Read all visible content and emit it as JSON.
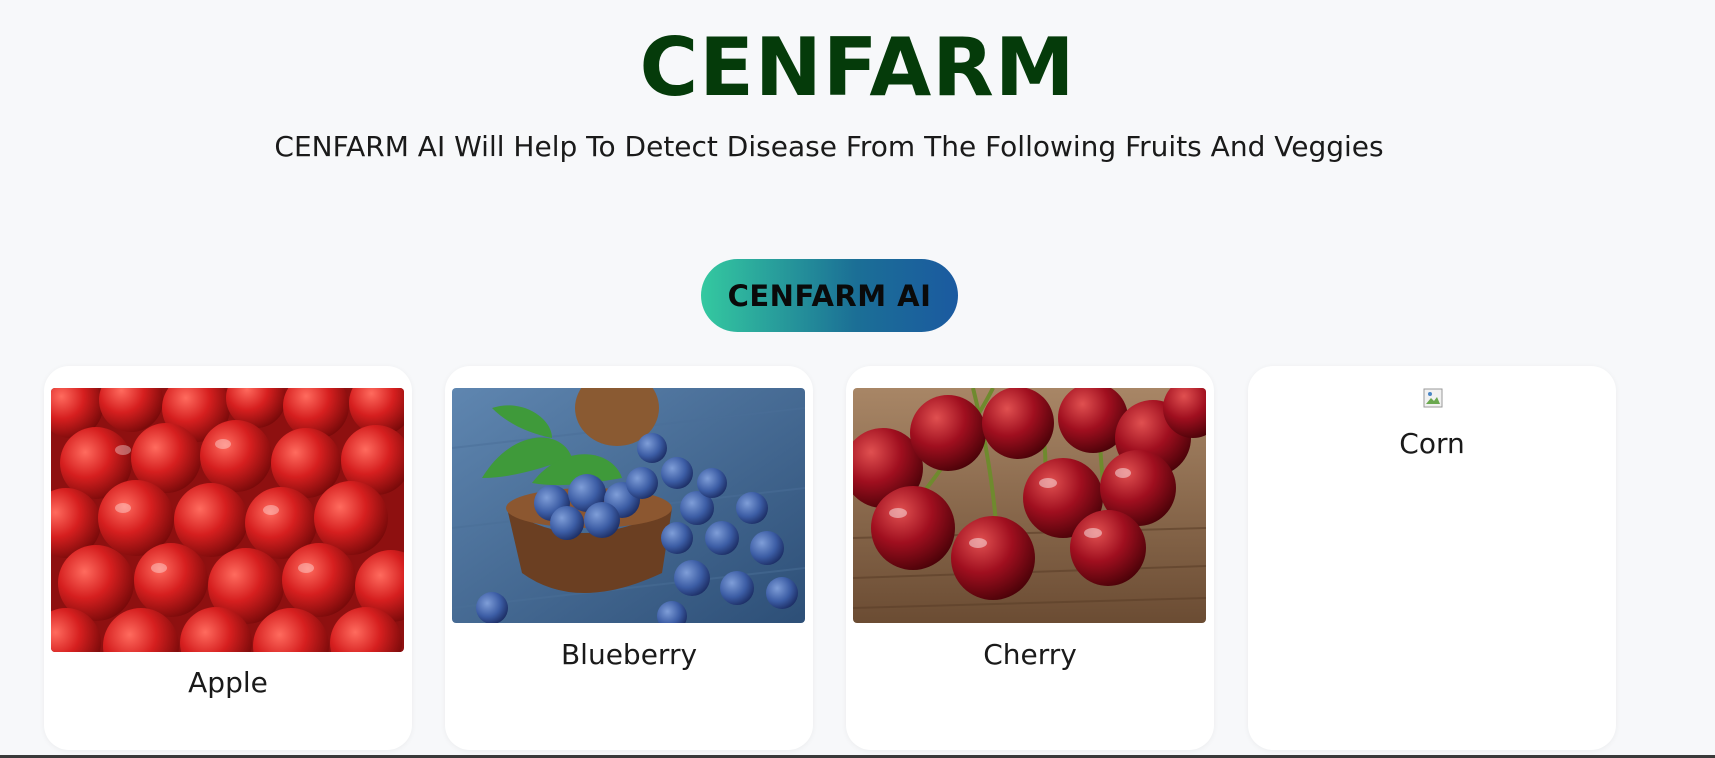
{
  "header": {
    "title": "CENFARM",
    "subtitle": "CENFARM AI Will Help To Detect Disease From The Following Fruits And Veggies",
    "title_color": "#053b0a"
  },
  "cta": {
    "label": "CENFARM AI",
    "gradient": [
      "#34c9a0",
      "#1b5aa0"
    ]
  },
  "cards": [
    {
      "label": "Apple",
      "image": "apples-photo"
    },
    {
      "label": "Blueberry",
      "image": "blueberries-photo"
    },
    {
      "label": "Cherry",
      "image": "cherries-photo"
    },
    {
      "label": "Corn",
      "image": "broken-image-icon"
    }
  ]
}
